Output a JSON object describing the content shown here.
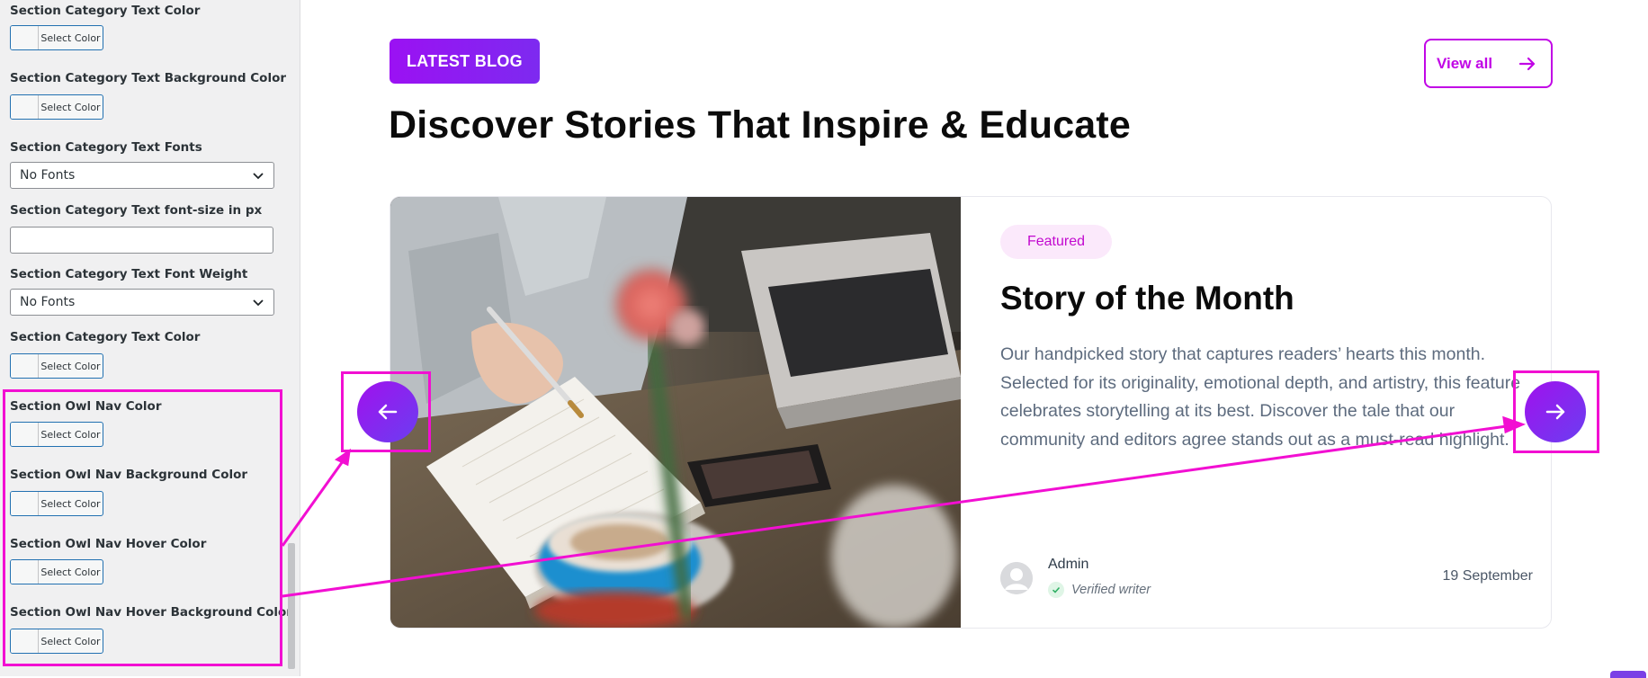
{
  "panel": {
    "select_color_label": "Select Color",
    "labels": [
      "Section Category Text Color",
      "Section Category Text Background Color",
      "Section Category Text Fonts",
      "Section Category Text font-size in px",
      "Section Category Text Font Weight",
      "Section Category Text Color",
      "Section Owl Nav Color",
      "Section Owl Nav Background Color",
      "Section Owl Nav Hover Color",
      "Section Owl Nav Hover Background Color"
    ],
    "fonts_select_value": "No Fonts",
    "font_weight_select_value": "No Fonts",
    "font_size_value": ""
  },
  "main": {
    "badge": "LATEST BLOG",
    "view_all": "View all",
    "section_title": "Discover Stories That Inspire & Educate",
    "card": {
      "tag": "Featured",
      "title": "Story of the Month",
      "description": "Our handpicked story that captures readers’ hearts this month. Selected for its originality, emotional depth, and artistry, this feature celebrates storytelling at its best. Discover the tale that our community and editors agree stands out as a must-read highlight.",
      "author": "Admin",
      "verified": "Verified writer",
      "date": "19 September"
    }
  },
  "colors": {
    "accent_gradient_start": "#9b11f3",
    "accent_gradient_end": "#6b3ef0",
    "highlight": "#f20fd2",
    "featured_bg": "#fbe9fb",
    "featured_text": "#c209cf"
  },
  "icons": {
    "prev": "arrow-left-icon",
    "next": "arrow-right-icon",
    "view_all": "arrow-right-icon",
    "select": "chevron-down-icon",
    "verified": "check-icon",
    "avatar": "user-icon"
  }
}
